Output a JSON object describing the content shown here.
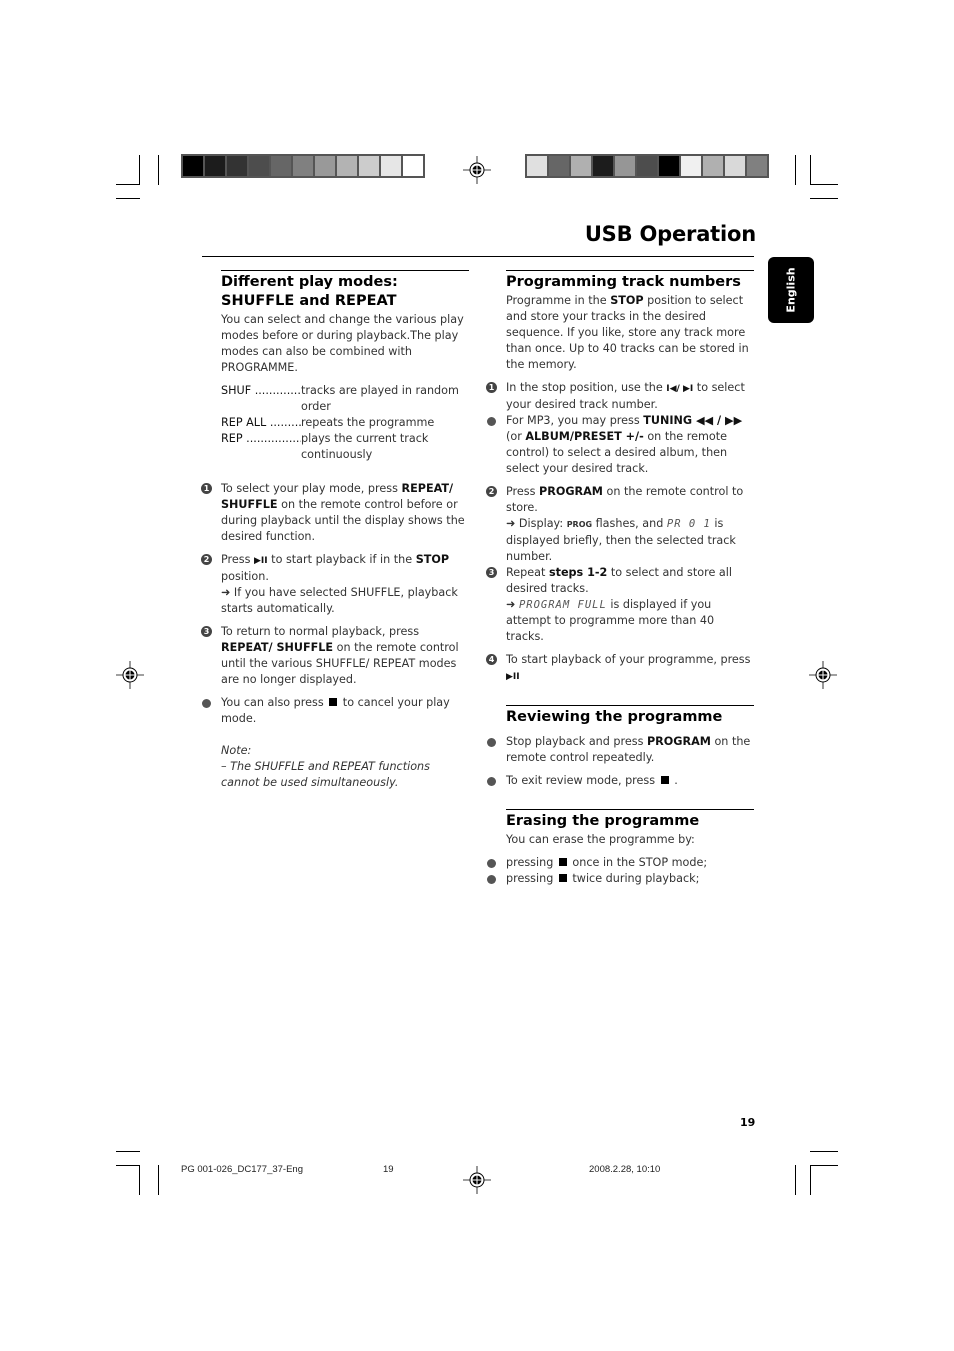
{
  "page": {
    "title": "USB Operation",
    "language_tab": "English",
    "page_number": "19"
  },
  "color_bars": {
    "left": [
      "#000000",
      "#1c1c1c",
      "#333333",
      "#4d4d4d",
      "#666666",
      "#808080",
      "#999999",
      "#b3b3b3",
      "#cccccc",
      "#e6e6e6",
      "#ffffff"
    ],
    "right": [
      "#e0e0e0",
      "#666666",
      "#b0b0b0",
      "#1c1c1c",
      "#969696",
      "#4d4d4d",
      "#000000",
      "#f0f0f0",
      "#b0b0b0",
      "#d9d9d9",
      "#808080"
    ]
  },
  "left": {
    "heading": "Different play modes: SHUFFLE and REPEAT",
    "intro": "You can select and change the various play modes before or during playback.The play modes can also be combined with PROGRAMME.",
    "modes": [
      {
        "key": "SHUF ......................",
        "desc": "tracks are played in random order"
      },
      {
        "key": "REP ALL ..................",
        "desc": "repeats the programme"
      },
      {
        "key": "REP ..........................",
        "desc": "plays the current track continuously"
      }
    ],
    "steps": [
      {
        "marker": "1",
        "pre": "To select your play mode, press ",
        "bold": "REPEAT/ SHUFFLE",
        "post": " on the remote control before or during playback until the display shows the desired function."
      },
      {
        "marker": "2",
        "pre": "Press ",
        "icon": "▶II",
        "mid": " to start playback if in the ",
        "bold": "STOP",
        "post": " position.",
        "result": "➜ If you have selected SHUFFLE, playback starts automatically."
      },
      {
        "marker": "3",
        "pre": "To return to normal playback, press ",
        "bold": "REPEAT/ SHUFFLE",
        "post": " on the remote control until the various SHUFFLE/ REPEAT modes are no longer displayed."
      }
    ],
    "bullet": {
      "pre": "You can also press ",
      "post": " to cancel your play mode."
    },
    "note_label": "Note:",
    "note_text": "– The SHUFFLE and REPEAT functions cannot be used simultaneously."
  },
  "right": {
    "programming": {
      "heading": "Programming track numbers",
      "intro_pre": "Programme in the ",
      "intro_bold": "STOP",
      "intro_post": " position to select and store your tracks in the desired sequence. If you like, store any track more than once. Up to 40 tracks can be stored in the memory.",
      "step1": {
        "marker": "1",
        "pre": "In the stop position, use the ",
        "icon": "I◀/ ▶I",
        "post": " to select your desired track number."
      },
      "bullet_mp3": {
        "pre": "For MP3, you may press ",
        "bold1": "TUNING ◀◀ / ▶▶",
        "mid": " (or ",
        "bold2": "ALBUM/PRESET +/-",
        "post": "  on the remote control) to select a desired album, then select your desired track."
      },
      "step2": {
        "marker": "2",
        "pre": "Press ",
        "bold": "PROGRAM",
        "post": " on the remote control to store.",
        "result_pre": "➜ Display: ",
        "prog": "PROG",
        "result_mid": " flashes, and ",
        "lcd": "PR 0 1",
        "result_post": " is displayed briefly, then the selected track number."
      },
      "step3": {
        "marker": "3",
        "pre": "Repeat ",
        "bold": "steps 1-2",
        "post": " to select and store all desired tracks.",
        "result_pre": "➜ ",
        "lcd": "PROGRAM FULL",
        "result_post": " is displayed if you attempt to programme more than 40 tracks."
      },
      "step4": {
        "marker": "4",
        "pre": "To start playback of your programme, press ",
        "icon": "▶II"
      }
    },
    "reviewing": {
      "heading": "Reviewing the programme",
      "bullet1_pre": "Stop playback and press ",
      "bullet1_bold": "PROGRAM",
      "bullet1_post": " on the remote control repeatedly.",
      "bullet2_pre": "To exit review mode, press ",
      "bullet2_post": " ."
    },
    "erasing": {
      "heading": "Erasing the programme",
      "intro": "You can erase the programme by:",
      "bullet1_pre": "pressing ",
      "bullet1_post": " once in the STOP mode;",
      "bullet2_pre": "pressing ",
      "bullet2_post": " twice during playback;"
    }
  },
  "footer": {
    "file": "PG 001-026_DC177_37-Eng",
    "page": "19",
    "timestamp": "2008.2.28, 10:10"
  }
}
